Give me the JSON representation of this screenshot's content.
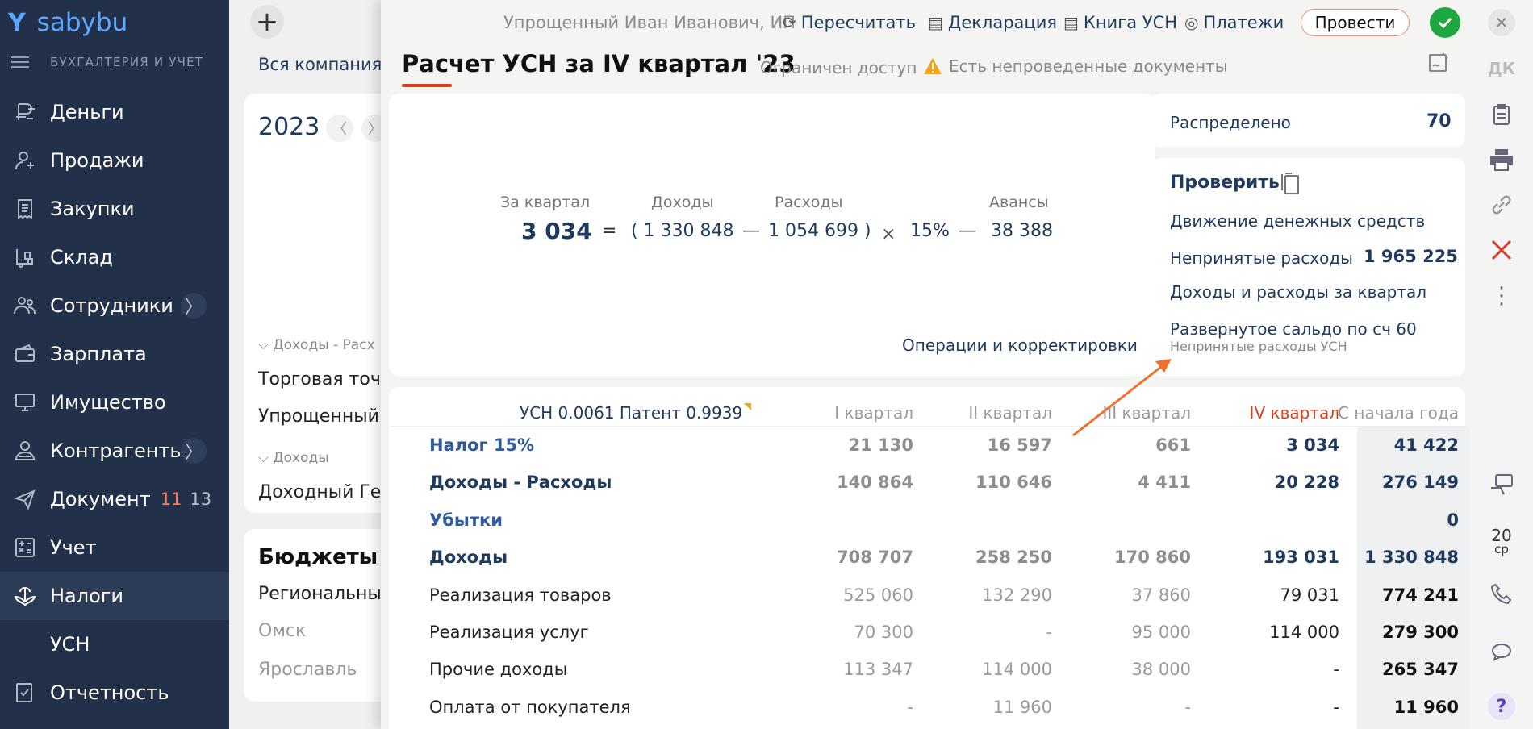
{
  "app": {
    "brand": "sabybu",
    "brand_mark": "Y",
    "section_subtitle": "БУХГАЛТЕРИЯ И УЧЕТ"
  },
  "sidebar": {
    "items": [
      {
        "label": "Деньги",
        "icon": "money-icon"
      },
      {
        "label": "Продажи",
        "icon": "sales-icon"
      },
      {
        "label": "Закупки",
        "icon": "purchases-icon"
      },
      {
        "label": "Склад",
        "icon": "warehouse-icon"
      },
      {
        "label": "Сотрудники",
        "icon": "employees-icon",
        "arrow": "〉"
      },
      {
        "label": "Зарплата",
        "icon": "salary-icon"
      },
      {
        "label": "Имущество",
        "icon": "property-icon"
      },
      {
        "label": "Контрагенты",
        "icon": "contractors-icon",
        "arrow": "〉"
      },
      {
        "label": "Документ",
        "icon": "documents-icon",
        "count_new": "11",
        "count_total": "13"
      },
      {
        "label": "Учет",
        "icon": "accounting-icon"
      },
      {
        "label": "Налоги",
        "icon": "taxes-icon",
        "active": true
      },
      {
        "label": "УСН",
        "icon": ""
      },
      {
        "label": "Отчетность",
        "icon": "reports-icon"
      }
    ]
  },
  "under_panel": {
    "plus": "+",
    "company": "Вся компания",
    "year": "2023",
    "prev": "〈",
    "next": "〉",
    "group1": "Доходы - Расх",
    "line1": "Торговая точ",
    "line2": "Упрощенный",
    "group2": "Доходы",
    "line3": "Доходный Ге",
    "budgets_title": "Бюджеты",
    "budget1": "Региональны",
    "budget2": "Омск",
    "budget3": "Ярославль"
  },
  "toolbar": {
    "entity": "Упрощенный Иван Иванович, ИП",
    "recalc": "Пересчитать",
    "declaration": "Декларация",
    "book": "Книга УСН",
    "payments": "Платежи",
    "post": "Провести"
  },
  "header": {
    "title": "Расчет УСН за IV квартал '23",
    "restricted": "Ограничен доступ",
    "warning": "Есть непроведенные документы"
  },
  "formula": {
    "quarter_label": "За квартал",
    "quarter_value": "3 034",
    "equals": "=",
    "income_label": "Доходы",
    "income_value": "( 1 330 848",
    "minus1": "—",
    "expense_label": "Расходы",
    "expense_value": "1 054 699 )",
    "times": "×",
    "rate": "15%",
    "minus2": "—",
    "advance_label": "Авансы",
    "advance_value": "38 388",
    "ops_link": "Операции и корректировки"
  },
  "side": {
    "distributed_label": "Распределено",
    "distributed_value": "70",
    "check_title": "Проверить",
    "cashflow": "Движение денежных средств",
    "unaccepted_label": "Непринятые расходы",
    "unaccepted_value": "1 965 225",
    "income_expense": "Доходы и расходы за квартал",
    "balance60": "Развернутое сальдо по сч 60",
    "balance60_sub": "Непринятые расходы УСН"
  },
  "table": {
    "ratio_label": "УСН 0.0061 Патент 0.9939",
    "columns": [
      "I квартал",
      "II квартал",
      "III квартал",
      "IV квартал",
      "С начала года"
    ],
    "rows": [
      {
        "label": "Налог 15%",
        "values": [
          "21 130",
          "16 597",
          "661",
          "3 034",
          "41 422"
        ],
        "style": "link"
      },
      {
        "label": "Доходы - Расходы",
        "values": [
          "140 864",
          "110 646",
          "4 411",
          "20 228",
          "276 149"
        ],
        "style": "bold"
      },
      {
        "label": "Убытки",
        "values": [
          "",
          "",
          "",
          "",
          "0"
        ],
        "style": "link"
      },
      {
        "label": "Доходы",
        "values": [
          "708 707",
          "258 250",
          "170 860",
          "193 031",
          "1 330 848"
        ],
        "style": "bold"
      },
      {
        "label": "Реализация товаров",
        "values": [
          "525 060",
          "132 290",
          "37 860",
          "79 031",
          "774 241"
        ],
        "style": "plain"
      },
      {
        "label": "Реализация услуг",
        "values": [
          "70 300",
          "-",
          "95 000",
          "114 000",
          "279 300"
        ],
        "style": "plain"
      },
      {
        "label": "Прочие доходы",
        "values": [
          "113 347",
          "114 000",
          "38 000",
          "-",
          "265 347"
        ],
        "style": "plain"
      },
      {
        "label": "Оплата от покупателя",
        "values": [
          "-",
          "11 960",
          "-",
          "-",
          "11 960"
        ],
        "style": "plain"
      }
    ]
  },
  "rightbar": {
    "initials": "ДК",
    "date_day": "20",
    "date_wd": "ср",
    "help": "?"
  },
  "colors": {
    "sidebar": "#223149",
    "link": "#1f3a5f",
    "accent": "#d94020",
    "success": "#1fa83f"
  }
}
